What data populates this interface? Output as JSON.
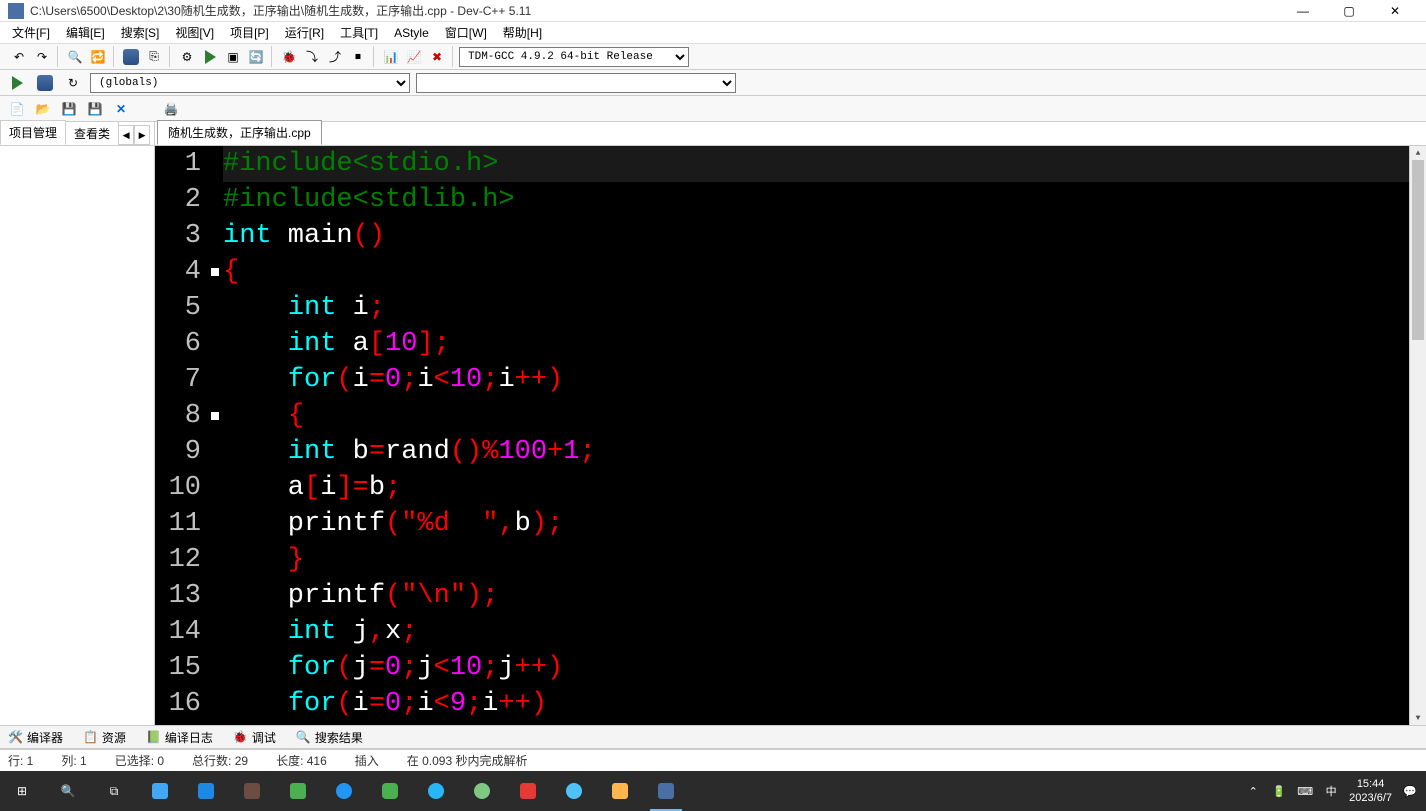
{
  "titlebar": {
    "path": "C:\\Users\\6500\\Desktop\\2\\30随机生成数，正序输出\\随机生成数，正序输出.cpp - Dev-C++ 5.11"
  },
  "menus": [
    "文件[F]",
    "编辑[E]",
    "搜索[S]",
    "视图[V]",
    "项目[P]",
    "运行[R]",
    "工具[T]",
    "AStyle",
    "窗口[W]",
    "帮助[H]"
  ],
  "compiler_select": "TDM-GCC 4.9.2 64-bit Release",
  "scope_select": "(globals)",
  "side_tabs": [
    "项目管理",
    "查看类"
  ],
  "editor_tab": "随机生成数，正序输出.cpp",
  "code": {
    "lines": [
      {
        "n": 1,
        "hl": true,
        "tokens": [
          [
            "pp",
            "#include<stdio.h>"
          ]
        ]
      },
      {
        "n": 2,
        "tokens": [
          [
            "pp",
            "#include<stdlib.h>"
          ]
        ]
      },
      {
        "n": 3,
        "tokens": [
          [
            "kw",
            "int"
          ],
          [
            "id",
            " main"
          ],
          [
            "sym",
            "()"
          ]
        ]
      },
      {
        "n": 4,
        "marker": true,
        "tokens": [
          [
            "sym",
            "{"
          ]
        ]
      },
      {
        "n": 5,
        "tokens": [
          [
            "id",
            "    "
          ],
          [
            "kw",
            "int"
          ],
          [
            "id",
            " i"
          ],
          [
            "sym",
            ";"
          ]
        ]
      },
      {
        "n": 6,
        "tokens": [
          [
            "id",
            "    "
          ],
          [
            "kw",
            "int"
          ],
          [
            "id",
            " a"
          ],
          [
            "sym",
            "["
          ],
          [
            "num",
            "10"
          ],
          [
            "sym",
            "];"
          ]
        ]
      },
      {
        "n": 7,
        "tokens": [
          [
            "id",
            "    "
          ],
          [
            "kw",
            "for"
          ],
          [
            "sym",
            "("
          ],
          [
            "id",
            "i"
          ],
          [
            "sym",
            "="
          ],
          [
            "num",
            "0"
          ],
          [
            "sym",
            ";"
          ],
          [
            "id",
            "i"
          ],
          [
            "sym",
            "<"
          ],
          [
            "num",
            "10"
          ],
          [
            "sym",
            ";"
          ],
          [
            "id",
            "i"
          ],
          [
            "sym",
            "++)"
          ]
        ]
      },
      {
        "n": 8,
        "marker": true,
        "tokens": [
          [
            "id",
            "    "
          ],
          [
            "sym",
            "{"
          ]
        ]
      },
      {
        "n": 9,
        "tokens": [
          [
            "id",
            "    "
          ],
          [
            "kw",
            "int"
          ],
          [
            "id",
            " b"
          ],
          [
            "sym",
            "="
          ],
          [
            "id",
            "rand"
          ],
          [
            "sym",
            "()%"
          ],
          [
            "num",
            "100"
          ],
          [
            "sym",
            "+"
          ],
          [
            "num",
            "1"
          ],
          [
            "sym",
            ";"
          ]
        ]
      },
      {
        "n": 10,
        "tokens": [
          [
            "id",
            "    a"
          ],
          [
            "sym",
            "["
          ],
          [
            "id",
            "i"
          ],
          [
            "sym",
            "]="
          ],
          [
            "id",
            "b"
          ],
          [
            "sym",
            ";"
          ]
        ]
      },
      {
        "n": 11,
        "tokens": [
          [
            "id",
            "    printf"
          ],
          [
            "sym",
            "("
          ],
          [
            "str",
            "\"%d  \""
          ],
          [
            "sym",
            ","
          ],
          [
            "id",
            "b"
          ],
          [
            "sym",
            ");"
          ]
        ]
      },
      {
        "n": 12,
        "tokens": [
          [
            "id",
            "    "
          ],
          [
            "sym",
            "}"
          ]
        ]
      },
      {
        "n": 13,
        "tokens": [
          [
            "id",
            "    printf"
          ],
          [
            "sym",
            "("
          ],
          [
            "str",
            "\"\\n\""
          ],
          [
            "sym",
            ");"
          ]
        ]
      },
      {
        "n": 14,
        "tokens": [
          [
            "id",
            "    "
          ],
          [
            "kw",
            "int"
          ],
          [
            "id",
            " j"
          ],
          [
            "sym",
            ","
          ],
          [
            "id",
            "x"
          ],
          [
            "sym",
            ";"
          ]
        ]
      },
      {
        "n": 15,
        "tokens": [
          [
            "id",
            "    "
          ],
          [
            "kw",
            "for"
          ],
          [
            "sym",
            "("
          ],
          [
            "id",
            "j"
          ],
          [
            "sym",
            "="
          ],
          [
            "num",
            "0"
          ],
          [
            "sym",
            ";"
          ],
          [
            "id",
            "j"
          ],
          [
            "sym",
            "<"
          ],
          [
            "num",
            "10"
          ],
          [
            "sym",
            ";"
          ],
          [
            "id",
            "j"
          ],
          [
            "sym",
            "++)"
          ]
        ]
      },
      {
        "n": 16,
        "tokens": [
          [
            "id",
            "    "
          ],
          [
            "kw",
            "for"
          ],
          [
            "sym",
            "("
          ],
          [
            "id",
            "i"
          ],
          [
            "sym",
            "="
          ],
          [
            "num",
            "0"
          ],
          [
            "sym",
            ";"
          ],
          [
            "id",
            "i"
          ],
          [
            "sym",
            "<"
          ],
          [
            "num",
            "9"
          ],
          [
            "sym",
            ";"
          ],
          [
            "id",
            "i"
          ],
          [
            "sym",
            "++)"
          ]
        ]
      }
    ]
  },
  "bottom_tabs": [
    {
      "icon": "🛠️",
      "label": "编译器"
    },
    {
      "icon": "📋",
      "label": "资源"
    },
    {
      "icon": "📗",
      "label": "编译日志"
    },
    {
      "icon": "🐞",
      "label": "调试"
    },
    {
      "icon": "🔍",
      "label": "搜索结果"
    }
  ],
  "status": {
    "line": "行:   1",
    "col": "列:   1",
    "sel": "已选择:   0",
    "total": "总行数:   29",
    "len": "长度:   416",
    "mode": "插入",
    "parse": "在 0.093 秒内完成解析"
  },
  "tray": {
    "ime": "中",
    "time": "15:44",
    "date": "2023/6/7"
  },
  "win_controls": {
    "min": "—",
    "max": "▢",
    "close": "✕"
  }
}
